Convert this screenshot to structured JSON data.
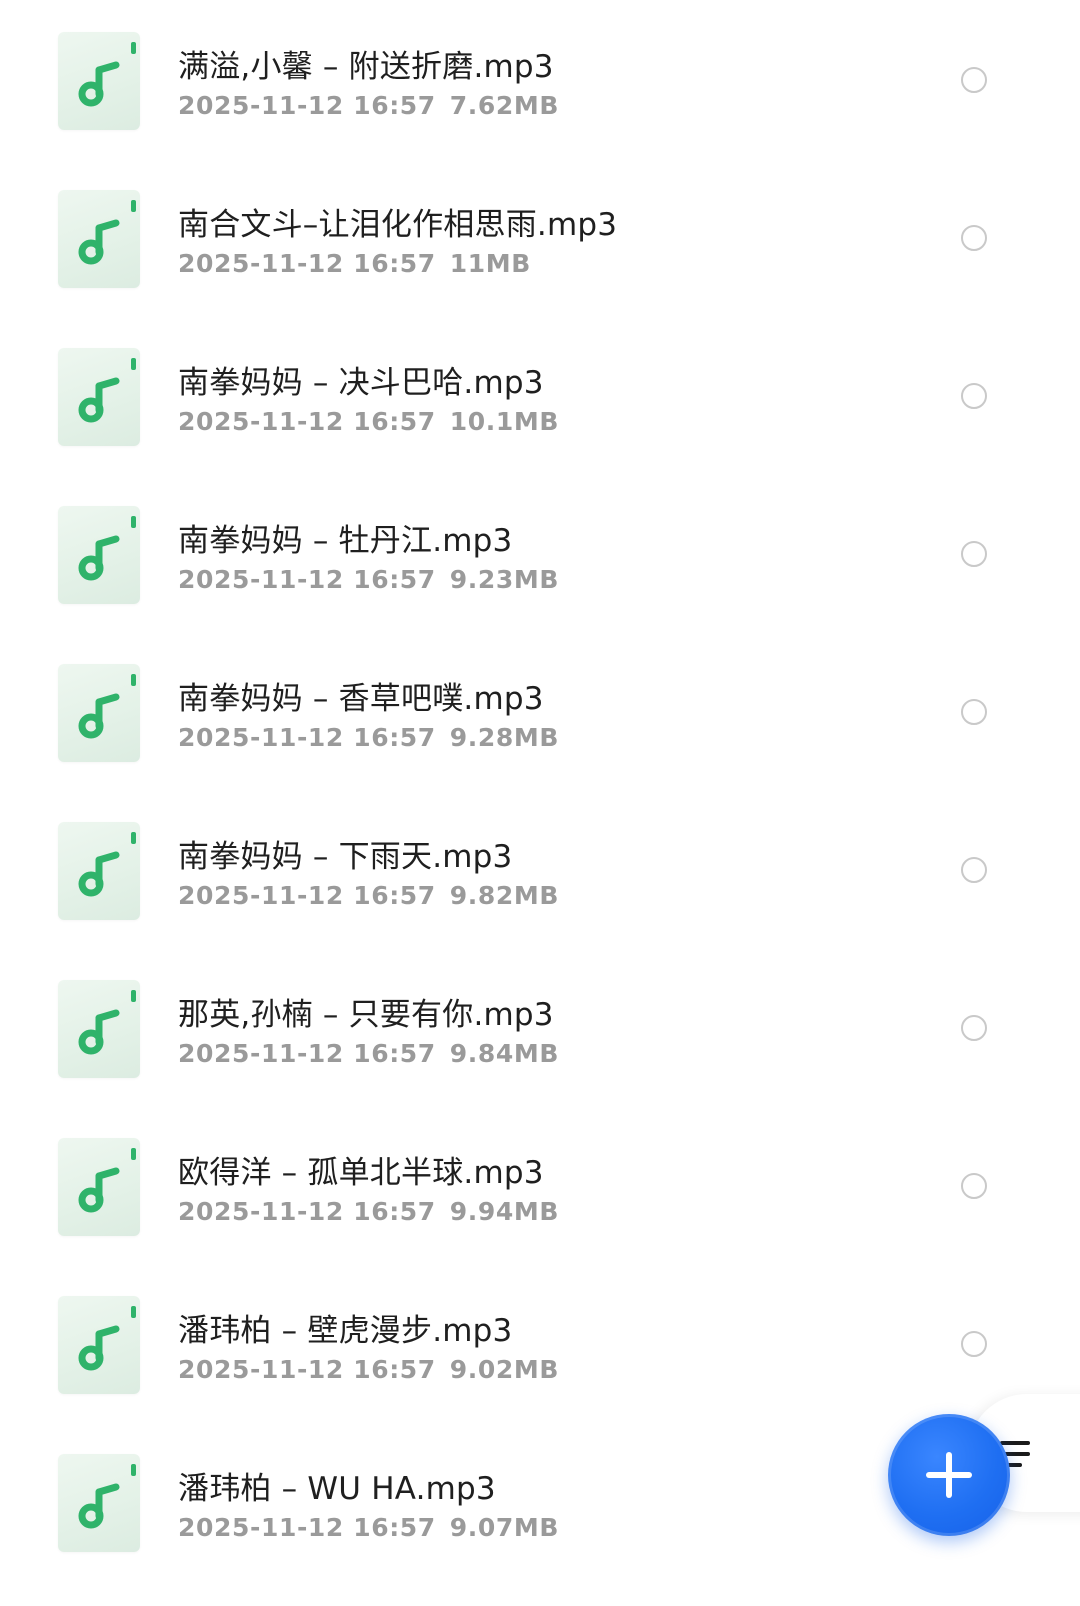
{
  "files": [
    {
      "name": "满溢,小馨 – 附送折磨.mp3",
      "date": "2025-11-12 16:57",
      "size": "7.62MB"
    },
    {
      "name": "南合文斗–让泪化作相思雨.mp3",
      "date": "2025-11-12 16:57",
      "size": "11MB"
    },
    {
      "name": "南拳妈妈 – 决斗巴哈.mp3",
      "date": "2025-11-12 16:57",
      "size": "10.1MB"
    },
    {
      "name": "南拳妈妈 – 牡丹江.mp3",
      "date": "2025-11-12 16:57",
      "size": "9.23MB"
    },
    {
      "name": "南拳妈妈 – 香草吧噗.mp3",
      "date": "2025-11-12 16:57",
      "size": "9.28MB"
    },
    {
      "name": "南拳妈妈 – 下雨天.mp3",
      "date": "2025-11-12 16:57",
      "size": "9.82MB"
    },
    {
      "name": "那英,孙楠 – 只要有你.mp3",
      "date": "2025-11-12 16:57",
      "size": "9.84MB"
    },
    {
      "name": "欧得洋 – 孤单北半球.mp3",
      "date": "2025-11-12 16:57",
      "size": "9.94MB"
    },
    {
      "name": "潘玮柏 – 壁虎漫步.mp3",
      "date": "2025-11-12 16:57",
      "size": "9.02MB"
    },
    {
      "name": "潘玮柏 – WU HA.mp3",
      "date": "2025-11-12 16:57",
      "size": "9.07MB"
    }
  ],
  "icons": {
    "file_icon": "music-note-icon",
    "select": "radio-icon",
    "fab": "plus-icon",
    "side": "menu-icon"
  },
  "colors": {
    "accent_green": "#2fb36a",
    "fab_blue": "#1f6ff2",
    "meta_gray": "#9a9a9a"
  }
}
